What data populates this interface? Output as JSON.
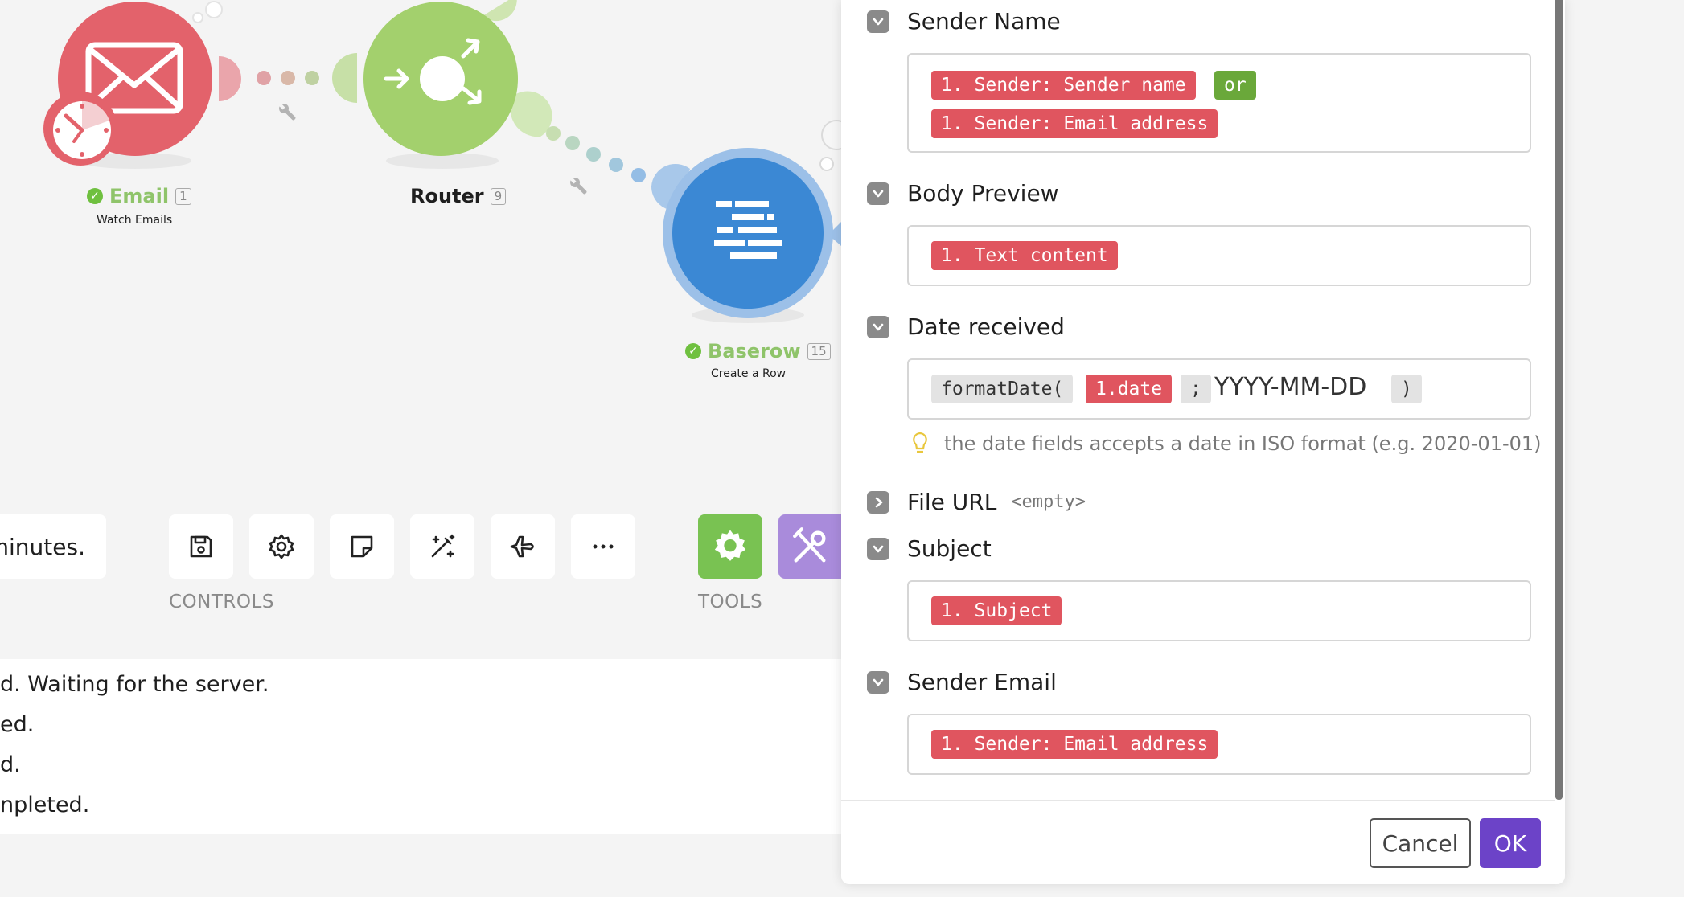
{
  "colors": {
    "email_module": "#e3626b",
    "router_module": "#a3d06d",
    "baserow_module": "#3b88d4",
    "tools_green": "#79c252",
    "tools_purple": "#a98bdb",
    "pill_red": "#e0555f",
    "pill_green": "#6aa83a",
    "ok_button": "#6c43c8"
  },
  "scenario": {
    "modules": [
      {
        "label": "Email",
        "count": "1",
        "subtitle": "Watch Emails",
        "icon": "envelope-icon"
      },
      {
        "label": "Router",
        "count": "9",
        "subtitle": "",
        "icon": "router-icon"
      },
      {
        "label": "Baserow",
        "count": "15",
        "subtitle": "Create a Row",
        "icon": "baserow-icon"
      }
    ]
  },
  "toolbar": {
    "message_fragment": "minutes.",
    "controls_label": "CONTROLS",
    "tools_label": "TOOLS",
    "controls": [
      {
        "name": "save-icon"
      },
      {
        "name": "settings-icon"
      },
      {
        "name": "notes-icon"
      },
      {
        "name": "magic-wand-icon"
      },
      {
        "name": "airplane-icon"
      },
      {
        "name": "more-icon"
      }
    ]
  },
  "log": {
    "lines": [
      "d. Waiting for the server.",
      "ed.",
      "d.",
      "npleted."
    ]
  },
  "panel": {
    "sender_name": {
      "label": "Sender Name",
      "tokens": [
        "1. Sender: Sender name",
        "or",
        "1. Sender: Email address"
      ]
    },
    "body_preview": {
      "label": "Body Preview",
      "tokens": [
        "1. Text content"
      ]
    },
    "date_received": {
      "label": "Date received",
      "fn_open": "formatDate(",
      "date_token": "1.date",
      "separator": ";",
      "format": "YYYY-MM-DD",
      "fn_close": ")",
      "hint": "the date fields accepts a date in ISO format (e.g. 2020-01-01)"
    },
    "file_url": {
      "label": "File URL",
      "value": "<empty>"
    },
    "subject": {
      "label": "Subject",
      "tokens": [
        "1. Subject"
      ]
    },
    "sender_email": {
      "label": "Sender Email",
      "tokens": [
        "1. Sender: Email address"
      ]
    },
    "buttons": {
      "cancel": "Cancel",
      "ok": "OK"
    }
  }
}
